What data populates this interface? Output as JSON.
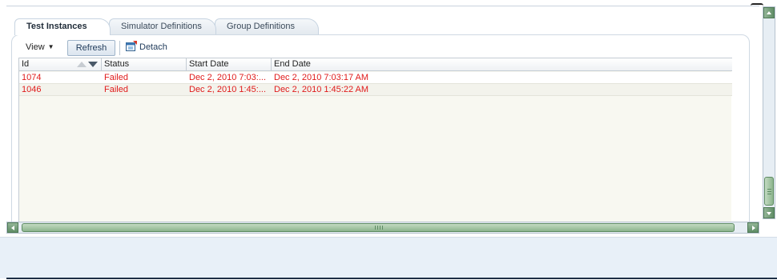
{
  "tabs": [
    {
      "label": "Test Instances",
      "active": true
    },
    {
      "label": "Simulator Definitions",
      "active": false
    },
    {
      "label": "Group Definitions",
      "active": false
    }
  ],
  "toolbar": {
    "view_label": "View",
    "refresh_label": "Refresh",
    "detach_label": "Detach"
  },
  "table": {
    "columns": [
      "Id",
      "Status",
      "Start Date",
      "End Date"
    ],
    "rows": [
      {
        "id": "1074",
        "status": "Failed",
        "start": "Dec 2, 2010 7:03:...",
        "end": "Dec 2, 2010 7:03:17 AM"
      },
      {
        "id": "1046",
        "status": "Failed",
        "start": "Dec 2, 2010 1:45:...",
        "end": "Dec 2, 2010 1:45:22 AM"
      }
    ]
  },
  "colors": {
    "failed_text": "#e01b1b",
    "scrollbar_green": "#8cb48d",
    "footer_bg": "#e8f0f8"
  },
  "icons": [
    "chevron-down-icon",
    "sort-ascending-icon",
    "sort-descending-icon",
    "detach-window-icon",
    "scroll-left-icon",
    "scroll-right-icon",
    "scroll-up-icon",
    "scroll-down-icon"
  ]
}
